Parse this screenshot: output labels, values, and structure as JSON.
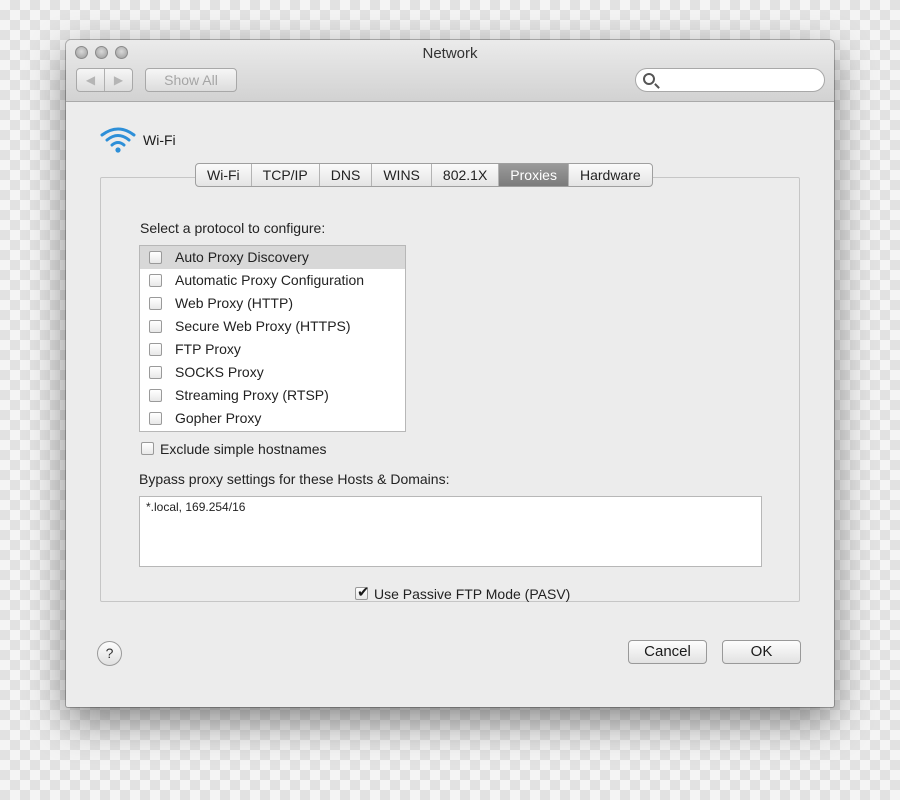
{
  "window": {
    "title": "Network"
  },
  "toolbar": {
    "back_icon": "chevron-left-icon",
    "forward_icon": "chevron-right-icon",
    "back_glyph": "◀",
    "forward_glyph": "▶",
    "show_all_label": "Show All",
    "search_placeholder": ""
  },
  "interface": {
    "name": "Wi-Fi",
    "icon": "wifi-icon"
  },
  "tabs": [
    {
      "label": "Wi-Fi",
      "active": false
    },
    {
      "label": "TCP/IP",
      "active": false
    },
    {
      "label": "DNS",
      "active": false
    },
    {
      "label": "WINS",
      "active": false
    },
    {
      "label": "802.1X",
      "active": false
    },
    {
      "label": "Proxies",
      "active": true
    },
    {
      "label": "Hardware",
      "active": false
    }
  ],
  "proxies": {
    "select_label": "Select a protocol to configure:",
    "protocols": [
      {
        "label": "Auto Proxy Discovery",
        "checked": false,
        "selected": true
      },
      {
        "label": "Automatic Proxy Configuration",
        "checked": false,
        "selected": false
      },
      {
        "label": "Web Proxy (HTTP)",
        "checked": false,
        "selected": false
      },
      {
        "label": "Secure Web Proxy (HTTPS)",
        "checked": false,
        "selected": false
      },
      {
        "label": "FTP Proxy",
        "checked": false,
        "selected": false
      },
      {
        "label": "SOCKS Proxy",
        "checked": false,
        "selected": false
      },
      {
        "label": "Streaming Proxy (RTSP)",
        "checked": false,
        "selected": false
      },
      {
        "label": "Gopher Proxy",
        "checked": false,
        "selected": false
      }
    ],
    "exclude_simple_label": "Exclude simple hostnames",
    "exclude_simple_checked": false,
    "bypass_label": "Bypass proxy settings for these Hosts & Domains:",
    "bypass_value": "*.local, 169.254/16",
    "pasv_label": "Use Passive FTP Mode (PASV)",
    "pasv_checked": true,
    "check_glyph": "✔"
  },
  "buttons": {
    "help_label": "?",
    "cancel_label": "Cancel",
    "ok_label": "OK"
  },
  "colors": {
    "accent_tab": "#7b7b7b",
    "wifi_blue": "#2d8fd8"
  }
}
